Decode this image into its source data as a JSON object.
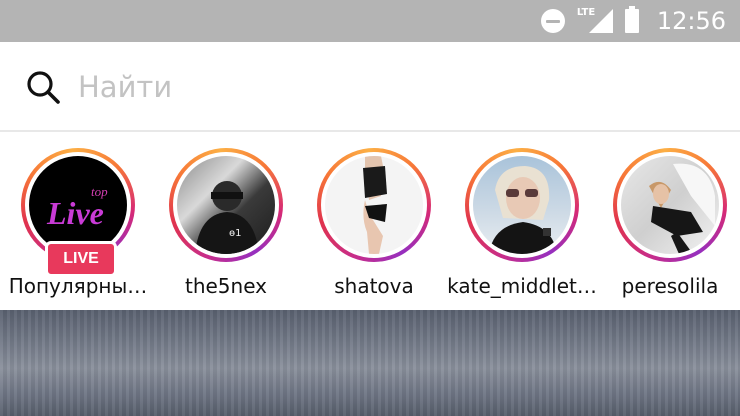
{
  "status_bar": {
    "network": "LTE",
    "time": "12:56",
    "icons": [
      "do-not-disturb-icon",
      "signal-icon",
      "battery-icon"
    ]
  },
  "search": {
    "placeholder": "Найти",
    "value": ""
  },
  "stories": [
    {
      "username": "Популярны…",
      "live": true,
      "badge": "LIVE",
      "avatar_text_top": "top",
      "avatar_text_main": "Live"
    },
    {
      "username": "the5nex",
      "live": false
    },
    {
      "username": "shatova",
      "live": false
    },
    {
      "username": "kate_middlet…",
      "live": false
    },
    {
      "username": "peresolila",
      "live": false
    }
  ],
  "colors": {
    "status_bar": "#b4b4b4",
    "live_badge": "#e8395c",
    "ring_gradient": [
      "#c72d8b",
      "#e0334e",
      "#f77737",
      "#fcaf45"
    ]
  }
}
